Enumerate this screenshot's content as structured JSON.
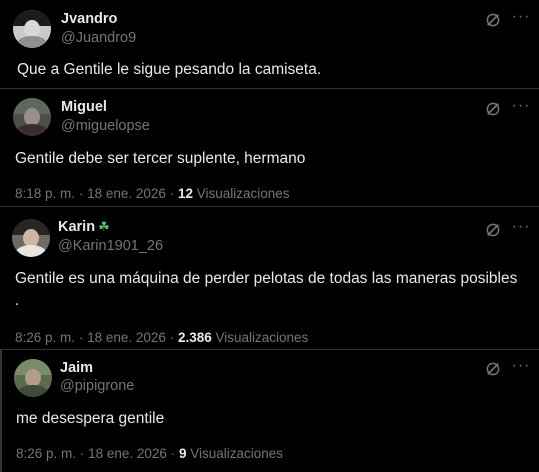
{
  "posts": [
    {
      "name": "Jvandro",
      "handle": "@Juandro9",
      "text": "Que a Gentile le sigue pesando la camiseta."
    },
    {
      "name": "Miguel",
      "handle": "@miguelopse",
      "text": "Gentile debe ser tercer suplente, hermano",
      "time": "8:18 p. m.",
      "date": "18 ene. 2026",
      "views_count": "12",
      "views_label": "Visualizaciones"
    },
    {
      "name": "Karin",
      "name_emoji": "☘",
      "handle": "@Karin1901_26",
      "text_line1": "Gentile es una máquina de perder pelotas de todas las maneras posibles",
      "text_line2": ".",
      "time": "8:26 p. m.",
      "date": "18 ene. 2026",
      "views_count": "2.386",
      "views_label": "Visualizaciones"
    },
    {
      "name": "Jaim",
      "handle": "@pipigrone",
      "text": "me desespera gentile",
      "time": "8:26 p. m.",
      "date": "18 ene. 2026",
      "views_count": "9",
      "views_label": "Visualizaciones"
    }
  ],
  "separator": "·",
  "more_glyph": "···",
  "icons": [
    "grok-icon",
    "more-icon",
    "avatar",
    "clover-emoji"
  ],
  "colors": {
    "background": "#000000",
    "text": "#e7e9ea",
    "muted": "#71767b",
    "border": "#2f3336"
  }
}
